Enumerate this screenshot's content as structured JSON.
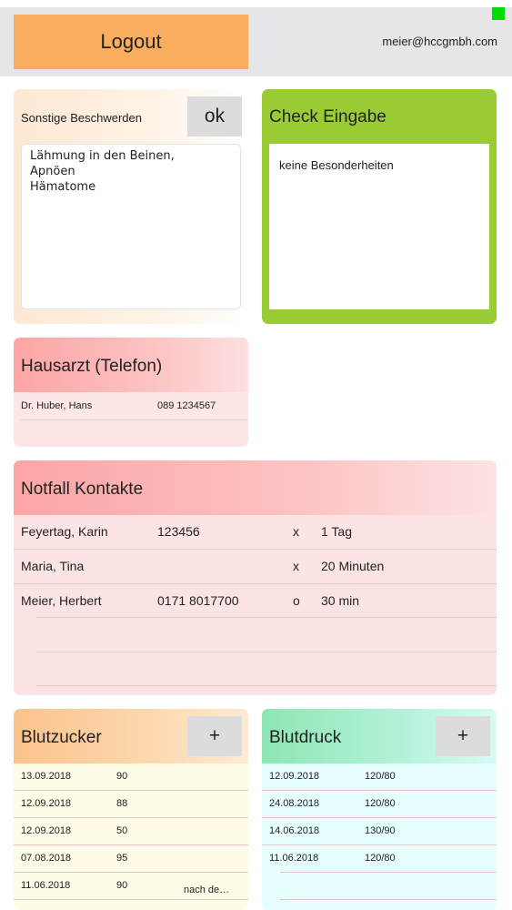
{
  "header": {
    "logout_label": "Logout",
    "user_email": "meier@hccgmbh.com",
    "status_color": "#00dd00"
  },
  "complaints": {
    "label": "Sonstige Beschwerden",
    "ok_label": "ok",
    "text": "Lähmung in den Beinen,\nApnöen\nHämatome"
  },
  "check": {
    "title": "Check Eingabe",
    "result": "keine Besonderheiten"
  },
  "doctor": {
    "title": "Hausarzt (Telefon)",
    "name": "Dr. Huber, Hans",
    "phone": "089 1234567"
  },
  "emergency": {
    "title": "Notfall Kontakte",
    "contacts": [
      {
        "name": "Feyertag, Karin",
        "phone": "123456",
        "flag": "x",
        "time": "1 Tag"
      },
      {
        "name": "Maria, Tina",
        "phone": "",
        "flag": "x",
        "time": "20 Minuten"
      },
      {
        "name": "Meier, Herbert",
        "phone": "0171 8017700",
        "flag": "o",
        "time": "30 min"
      }
    ]
  },
  "blood_sugar": {
    "title": "Blutzucker",
    "add_label": "+",
    "more_label": "nach de…",
    "rows": [
      {
        "date": "13.09.2018",
        "value": "90"
      },
      {
        "date": "12.09.2018",
        "value": "88"
      },
      {
        "date": "12.09.2018",
        "value": "50"
      },
      {
        "date": "07.08.2018",
        "value": "95"
      },
      {
        "date": "11.06.2018",
        "value": "90"
      }
    ]
  },
  "blood_pressure": {
    "title": "Blutdruck",
    "add_label": "+",
    "rows": [
      {
        "date": "12.09.2018",
        "value": "120/80"
      },
      {
        "date": "24.08.2018",
        "value": "120/80"
      },
      {
        "date": "14.06.2018",
        "value": "130/90"
      },
      {
        "date": "11.06.2018",
        "value": "120/80"
      }
    ]
  }
}
